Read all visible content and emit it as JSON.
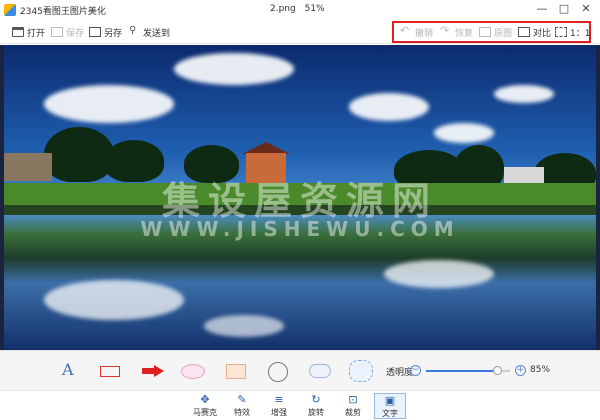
{
  "window": {
    "title": "2345看图王图片美化",
    "file_name": "2.png",
    "zoom": "51%",
    "minimize": "—",
    "maximize": "□",
    "close": "✕"
  },
  "toolbar": {
    "open": "打开",
    "save": "保存",
    "save_as": "另存",
    "send_to": "发送到",
    "undo": "撤销",
    "redo": "恢复",
    "original": "原图",
    "compare": "对比",
    "actual_size": "1：1"
  },
  "canvas": {
    "watermark_cn": "集设屋资源网",
    "watermark_en": "WWW.JISHEWU.COM"
  },
  "shapes": {
    "text_tool": "A",
    "opacity_label": "透明度",
    "opacity_value": "85%",
    "opacity_level": 0.85,
    "minus": "−",
    "plus": "+"
  },
  "bottom_tools": [
    {
      "label": "马赛克",
      "icon": "✥"
    },
    {
      "label": "特效",
      "icon": "✎"
    },
    {
      "label": "增强",
      "icon": "≡"
    },
    {
      "label": "旋转",
      "icon": "↻"
    },
    {
      "label": "裁剪",
      "icon": "⊡"
    },
    {
      "label": "文字",
      "icon": "▣"
    }
  ],
  "colors": {
    "highlight_border": "#e02020",
    "accent": "#3a7ae0"
  }
}
